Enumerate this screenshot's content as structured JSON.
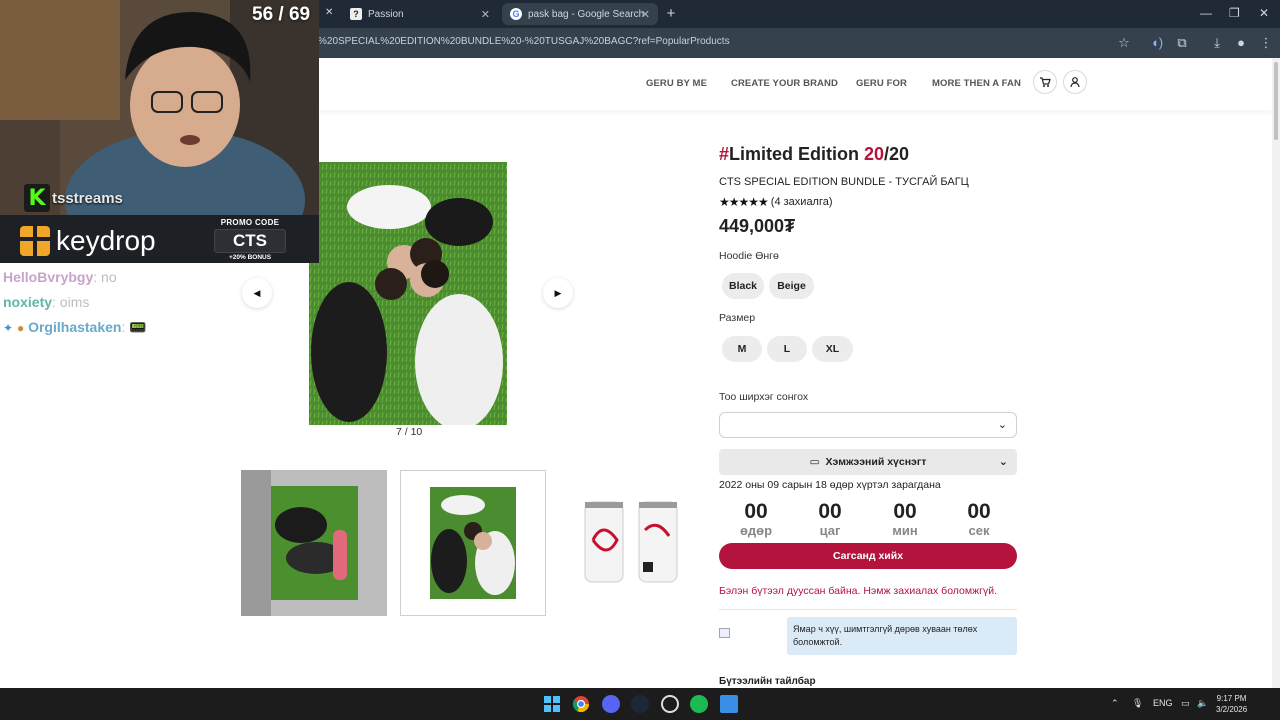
{
  "browser": {
    "tabs": [
      {
        "title": "Passion",
        "favicon": "?"
      },
      {
        "title": "pask bag - Google Search",
        "favicon": "G"
      }
    ],
    "url": "%20SPECIAL%20EDITION%20BUNDLE%20-%20TUSGAJ%20BAGC?ref=PopularProducts"
  },
  "nav": {
    "items": [
      "GERU BY ME",
      "CREATE YOUR BRAND",
      "GERU FOR",
      "MORE THEN A FAN"
    ]
  },
  "gallery": {
    "counter": "7 / 10"
  },
  "product": {
    "title_hash": "#",
    "title_main": "Limited Edition ",
    "title_count": "20",
    "title_total": "/20",
    "subtitle": "CTS SPECIAL EDITION BUNDLE - ТУСГАЙ БАГЦ",
    "stars": "★★★★★",
    "reviews": "(4 захиалга)",
    "price": "449,000₮",
    "color_label": "Hoodie Өнгө",
    "colors": [
      "Black",
      "Beige"
    ],
    "size_label": "Размер",
    "sizes": [
      "M",
      "L",
      "XL"
    ],
    "qty_label": "Тоо ширхэг сонгох",
    "size_guide": "Хэмжээний хүснэгт",
    "sale_until": "2022 оны 09 сарын 18 өдөр хүртэл зарагдана",
    "countdown": [
      {
        "value": "00",
        "unit": "өдөр"
      },
      {
        "value": "00",
        "unit": "цаг"
      },
      {
        "value": "00",
        "unit": "мин"
      },
      {
        "value": "00",
        "unit": "сек"
      }
    ],
    "cart_button": "Сагсанд хийх",
    "sold_out": "Бэлэн бүтээл дууссан байна. Нэмж захиалах боломжгүй.",
    "payment_info": "Ямар ч хүү, шимтгэлгүй дөрөв хуваан төлөх боломжтой.",
    "description_heading": "Бүтээлийн тайлбар"
  },
  "stream": {
    "counter": "56 / 69",
    "channel": "tsstreams",
    "sponsor": "keydrop",
    "promo_label": "PROMO CODE",
    "promo_code": "CTS",
    "promo_bonus": "+20% BONUS",
    "chat": [
      {
        "user": "HelloBvrybgy",
        "sep": ": ",
        "msg": "no",
        "color": "#c9a3c9"
      },
      {
        "user": "noxiety",
        "sep": ": ",
        "msg": "oims",
        "color": "#5fb7a8"
      },
      {
        "user": "Orgilhastaken",
        "sep": ": ",
        "msg": "📟",
        "color": "#6aa9c9"
      }
    ]
  },
  "taskbar": {
    "lang": "ENG",
    "time": "9:17 PM",
    "date": "3/2/2026"
  },
  "colors": {
    "accent": "#b3133d",
    "tabbar": "#1f2a36",
    "addressbar": "#35414d",
    "info_bg": "#dbeaf7"
  }
}
